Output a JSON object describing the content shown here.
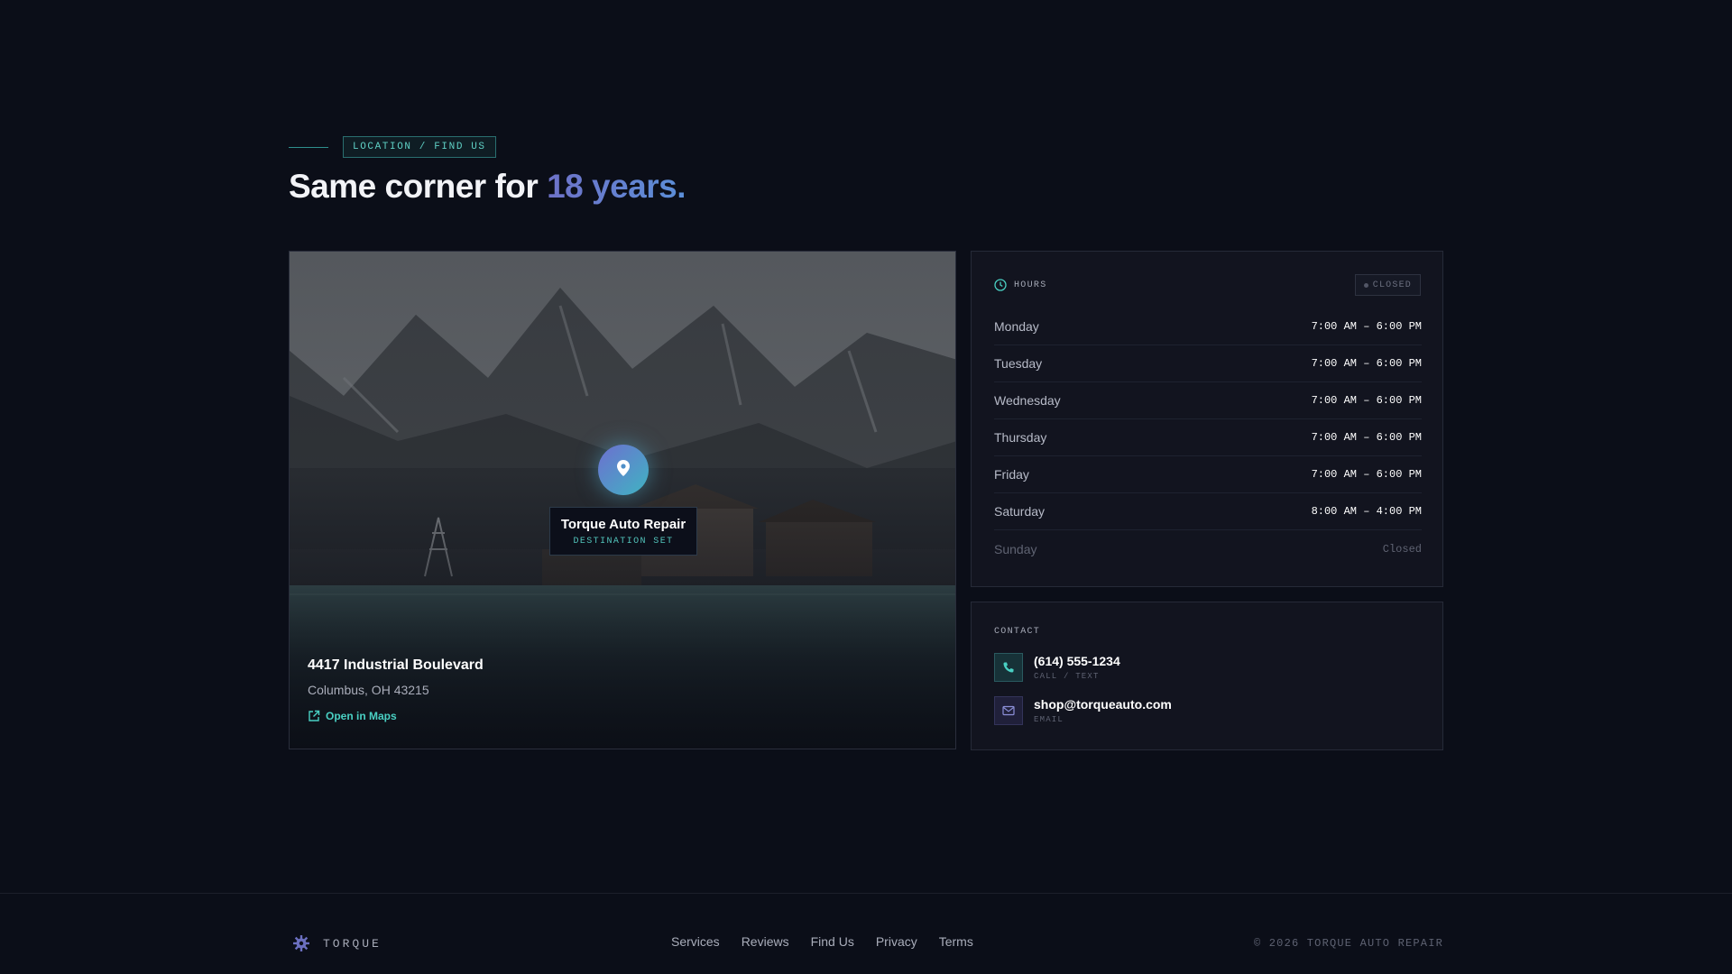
{
  "section": {
    "eyebrow": "LOCATION / FIND US",
    "headline_prefix": "Same corner for ",
    "headline_accent": "18 years."
  },
  "map": {
    "pin_name": "Torque Auto Repair",
    "pin_status": "DESTINATION SET",
    "street": "4417 Industrial Boulevard",
    "city": "Columbus, OH 43215",
    "open_maps_label": "Open in Maps",
    "icons": {
      "pin": "map-pin-icon",
      "external": "external-link-icon"
    }
  },
  "hours": {
    "title": "HOURS",
    "status": "CLOSED",
    "days": [
      {
        "day": "Monday",
        "time": "7:00 AM – 6:00 PM"
      },
      {
        "day": "Tuesday",
        "time": "7:00 AM – 6:00 PM"
      },
      {
        "day": "Wednesday",
        "time": "7:00 AM – 6:00 PM"
      },
      {
        "day": "Thursday",
        "time": "7:00 AM – 6:00 PM"
      },
      {
        "day": "Friday",
        "time": "7:00 AM – 6:00 PM"
      },
      {
        "day": "Saturday",
        "time": "8:00 AM – 4:00 PM"
      },
      {
        "day": "Sunday",
        "time": "Closed"
      }
    ]
  },
  "contact": {
    "title": "CONTACT",
    "phone": "(614) 555-1234",
    "phone_sub": "CALL / TEXT",
    "email": "shop@torqueauto.com",
    "email_sub": "EMAIL"
  },
  "footer": {
    "brand": "TORQUE",
    "nav": [
      "Services",
      "Reviews",
      "Find Us",
      "Privacy",
      "Terms"
    ],
    "copyright": "© 2026 TORQUE AUTO REPAIR"
  },
  "colors": {
    "background": "#0b0e18",
    "accent_teal": "#49d0c3",
    "accent_indigo": "#6e72c8"
  }
}
